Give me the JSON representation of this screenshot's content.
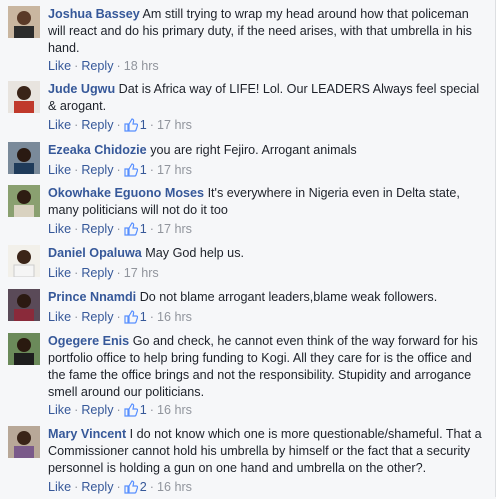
{
  "actions": {
    "like": "Like",
    "reply": "Reply",
    "separator": "·"
  },
  "colors": {
    "link": "#365899",
    "text": "#1d2129",
    "muted": "#90949c",
    "background": "#f6f7f9"
  },
  "comments": [
    {
      "name": "Joshua Bassey",
      "text": "Am still trying to wrap my head around how that policeman will react and do his primary duty, if the need arises, with that umbrella in his hand.",
      "likes": "",
      "time": "18 hrs"
    },
    {
      "name": "Jude Ugwu",
      "text": "Dat is Africa way of LIFE! Lol. Our LEADERS Always feel special & arogant.",
      "likes": "1",
      "time": "17 hrs"
    },
    {
      "name": "Ezeaka Chidozie",
      "text": "you are right Fejiro. Arrogant animals",
      "likes": "1",
      "time": "17 hrs"
    },
    {
      "name": "Okowhake Eguono Moses",
      "text": "It's everywhere in Nigeria even in Delta state, many politicians will not do it too",
      "likes": "1",
      "time": "17 hrs"
    },
    {
      "name": "Daniel Opaluwa",
      "text": "May God help us.",
      "likes": "",
      "time": "17 hrs"
    },
    {
      "name": "Prince Nnamdi",
      "text": "Do not blame arrogant leaders,blame weak followers.",
      "likes": "1",
      "time": "16 hrs"
    },
    {
      "name": "Ogegere Enis",
      "text": "Go and check, he cannot even think of the way forward for his portfolio office to help bring funding to Kogi. All they care for is the office and the fame the office brings and not the responsibility. Stupidity and arrogance smell around our politicians.",
      "likes": "1",
      "time": "16 hrs"
    },
    {
      "name": "Mary Vincent",
      "text": "I do not know which one is more questionable/shameful. That a Commissioner cannot hold his umbrella by himself or the fact that a security personnel is holding a gun on one hand and umbrella on the other?.",
      "likes": "2",
      "time": "16 hrs"
    }
  ]
}
